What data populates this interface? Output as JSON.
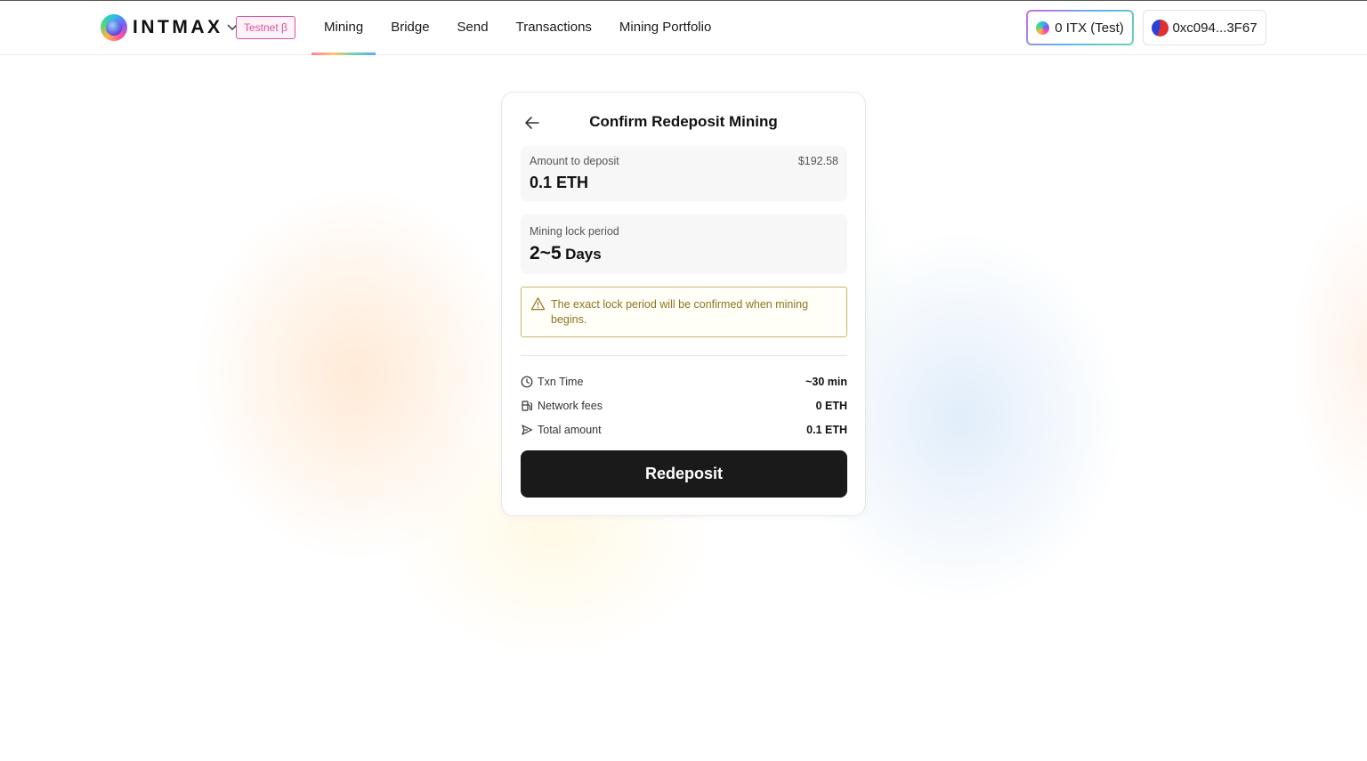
{
  "header": {
    "logo_text": "INTMAX",
    "testnet_badge": "Testnet β",
    "nav": [
      {
        "label": "Mining",
        "active": true
      },
      {
        "label": "Bridge",
        "active": false
      },
      {
        "label": "Send",
        "active": false
      },
      {
        "label": "Transactions",
        "active": false
      },
      {
        "label": "Mining Portfolio",
        "active": false
      }
    ],
    "balance_label": "0 ITX (Test)",
    "wallet_address": "0xc094...3F67"
  },
  "card": {
    "title": "Confirm Redeposit Mining",
    "deposit": {
      "label": "Amount to deposit",
      "amount": "0.1 ETH",
      "usd": "$192.58"
    },
    "lock": {
      "label": "Mining lock period",
      "range": "2~5",
      "unit": "Days"
    },
    "warning": "The exact lock period will be confirmed when mining begins.",
    "details": [
      {
        "icon": "clock-icon",
        "label": "Txn Time",
        "value": "~30 min"
      },
      {
        "icon": "fuel-pump-icon",
        "label": "Network fees",
        "value": "0 ETH"
      },
      {
        "icon": "send-icon",
        "label": "Total amount",
        "value": "0.1 ETH"
      }
    ],
    "submit_label": "Redeposit"
  },
  "colors": {
    "accent_dark": "#1a1a1a",
    "warning_border": "#c9b46a",
    "warning_text": "#8f7422",
    "testnet_pink": "#d3569e"
  }
}
